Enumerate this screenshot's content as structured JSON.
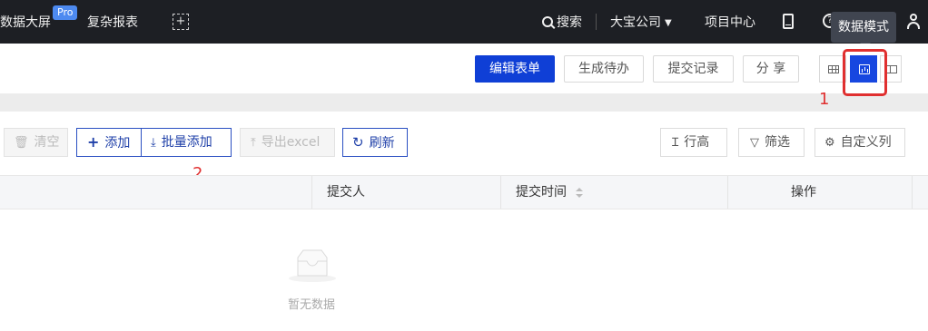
{
  "topnav": {
    "data_screen": "数据大屏",
    "pro_badge": "Pro",
    "complex_report": "复杂报表",
    "search": "搜索",
    "company": "大宝公司",
    "project_center": "项目中心",
    "tooltip": "数据模式"
  },
  "toolbar": {
    "edit_form": "编辑表单",
    "generate_todo": "生成待办",
    "submit_records": "提交记录",
    "share": "分 享"
  },
  "actions": {
    "clear": "清空",
    "add": "添加",
    "batch_add": "批量添加",
    "export_excel": "导出excel",
    "refresh": "刷新",
    "row_height": "行高",
    "filter": "筛选",
    "custom_columns": "自定义列"
  },
  "table": {
    "columns": [
      "提交人",
      "提交时间",
      "操作"
    ],
    "empty_text": "暂无数据"
  },
  "annotations": {
    "marker_1": "1",
    "marker_2": "2"
  },
  "colors": {
    "nav_bg": "#1d1f24",
    "primary": "#0f3fd6",
    "annotation": "#e03030"
  }
}
